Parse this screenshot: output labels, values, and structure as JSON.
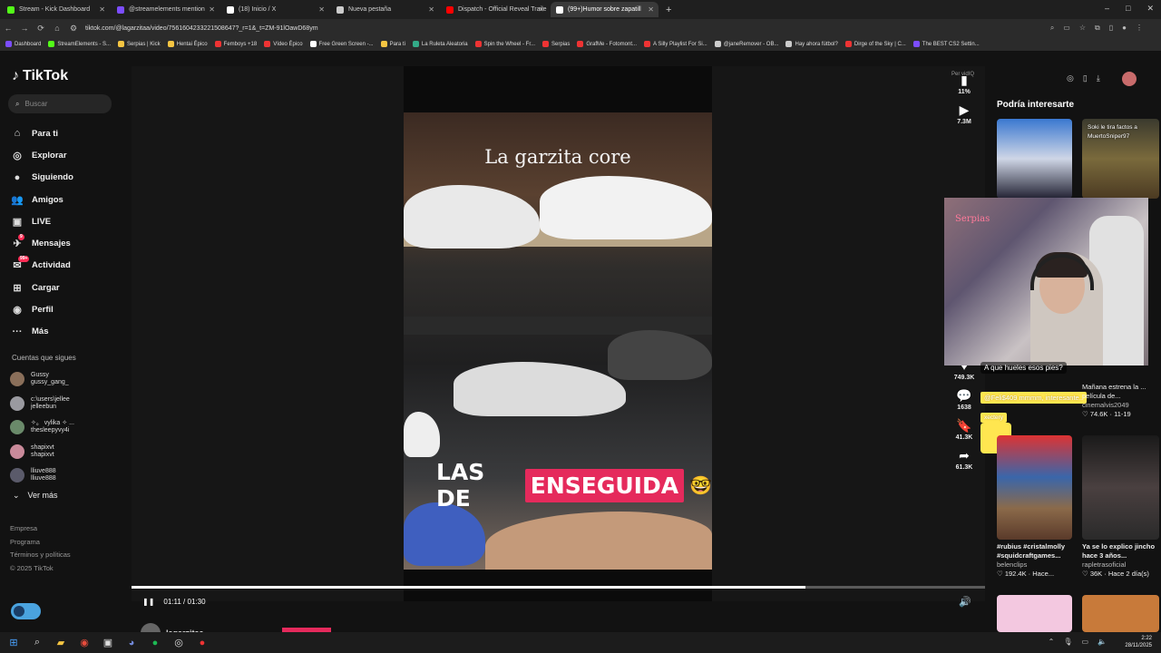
{
  "browser": {
    "tabs": [
      {
        "title": "Stream - Kick Dashboard",
        "color": "#53fc18"
      },
      {
        "title": "@streamelements mention",
        "color": "#7c4dff"
      },
      {
        "title": "(18) Inicio / X",
        "color": "#ffffff"
      },
      {
        "title": "Nueva pestaña",
        "color": "#cccccc"
      },
      {
        "title": "Dispatch - Official Reveal Traile",
        "color": "#ff0000"
      },
      {
        "title": "(99+)Humor sobre zapatill",
        "color": "#ffffff"
      }
    ],
    "new_tab": "+",
    "window_controls": [
      "–",
      "□",
      "✕"
    ],
    "url": "tiktok.com/@lagarzitaa/video/7561604233221508647?_r=1&_t=ZM-91lOawD68ym",
    "bookmarks": [
      "Dashboard",
      "StreamElements - S...",
      "Serpias | Kick",
      "Hentai Épico",
      "Femboys +18",
      "Vídeo Épico",
      "Free Green Screen -...",
      "Para ti",
      "La Ruleta Aleatoria",
      "Spin the Wheel - Fr...",
      "Serpias",
      "GrafMe - Fotomont...",
      "A Silly Playlist For Si...",
      "@janeRemover - OB...",
      "Hay ahora fútbol?",
      "Dirge of the Sky | C...",
      "The BEST CS2 Settin..."
    ]
  },
  "sidebar": {
    "logo": "TikTok",
    "search_placeholder": "Buscar",
    "nav": [
      {
        "label": "Para ti",
        "icon": "home-icon",
        "glyph": "⌂"
      },
      {
        "label": "Explorar",
        "icon": "compass-icon",
        "glyph": "◎"
      },
      {
        "label": "Siguiendo",
        "icon": "following-icon",
        "glyph": "●"
      },
      {
        "label": "Amigos",
        "icon": "friends-icon",
        "glyph": "👥"
      },
      {
        "label": "LIVE",
        "icon": "live-icon",
        "glyph": "▣"
      },
      {
        "label": "Mensajes",
        "icon": "messages-icon",
        "glyph": "✈",
        "badge": "9"
      },
      {
        "label": "Actividad",
        "icon": "activity-icon",
        "glyph": "✉",
        "badge": "99+"
      },
      {
        "label": "Cargar",
        "icon": "upload-icon",
        "glyph": "⊞"
      },
      {
        "label": "Perfil",
        "icon": "profile-icon",
        "glyph": "◉"
      },
      {
        "label": "Más",
        "icon": "more-icon",
        "glyph": "···"
      }
    ],
    "following_title": "Cuentas que sigues",
    "following": [
      {
        "name": "Gussy",
        "handle": "gussy_gang_"
      },
      {
        "name": "c:\\users\\jellee",
        "handle": "jelleebun"
      },
      {
        "name": "✧。 vylika ✧ ...",
        "handle": "thesleepyvy4i"
      },
      {
        "name": "shapixvt",
        "handle": "shapixvt"
      },
      {
        "name": "lliuve888",
        "handle": "lliuve888"
      }
    ],
    "ver_mas": "Ver más",
    "footer": [
      "Empresa",
      "Programa",
      "Términos y políticas",
      "© 2025 TikTok"
    ]
  },
  "video": {
    "title_overlay": "La garzita core",
    "caption_plain": "LAS DE",
    "caption_highlight": "ENSEGUIDA",
    "caption_emoji": "🤓",
    "time": "01:11 / 01:30",
    "progress": 0.79,
    "author": "lagarzitaa"
  },
  "actions": {
    "per_label": "Per vidIQ",
    "vidiq_percent": "11%",
    "views": "7.3M",
    "likes": "749.3K",
    "comments": "1638",
    "saves": "41.3K",
    "shares": "61.3K"
  },
  "suggest": {
    "title": "Podría interesarte",
    "items": [
      {
        "caption": "Soki le tira factos a MuertoSniper97"
      },
      {
        "caption": "Mañana estrena la ... película de...",
        "user": "cinemalvis2049",
        "likes": "74.6K",
        "date": "11-19"
      },
      {
        "caption": "#rubius #cristalmolly #squidcraftgames...",
        "user": "belenclips",
        "likes": "192.4K",
        "date": "Hace..."
      },
      {
        "caption": "Ya se lo explico jincho hace 3 años...",
        "user": "rapletrasoficial",
        "likes": "36K",
        "date": "Hace 2 día(s)"
      }
    ]
  },
  "stream_overlay": {
    "sign": "Serpias",
    "chat": [
      {
        "text": "A que hueles esos pies?"
      },
      {
        "text": "@Feli$409 mmmm, interesante.."
      },
      {
        "text": "xectery"
      }
    ]
  },
  "taskbar": {
    "time": "2:22",
    "date": "28/11/2025"
  }
}
